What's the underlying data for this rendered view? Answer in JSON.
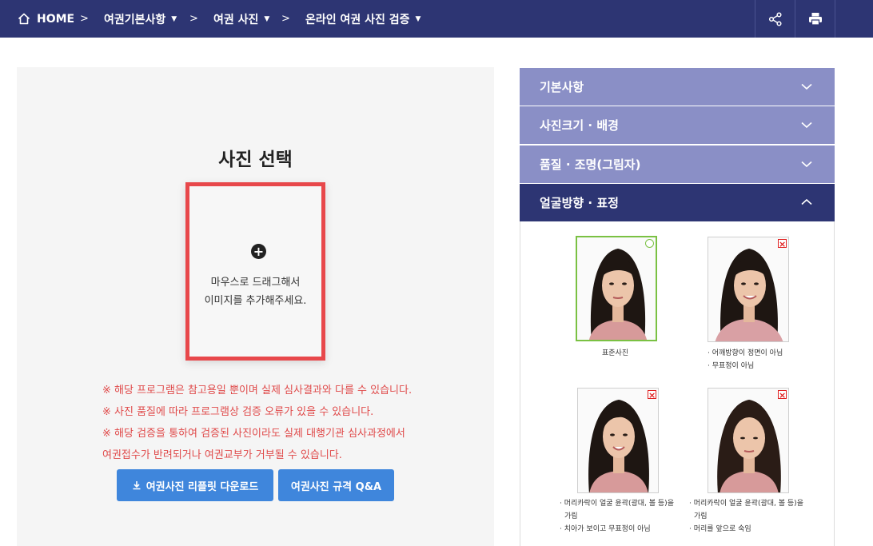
{
  "nav": {
    "home_label": "HOME",
    "crumbs": [
      {
        "label": "여권기본사항"
      },
      {
        "label": "여권 사진"
      },
      {
        "label": "온라인 여권 사진 검증"
      }
    ],
    "share_icon": "share-icon",
    "print_icon": "print-icon",
    "caret_icon": "caret-down-icon",
    "separator": ">"
  },
  "main": {
    "title": "사진 선택",
    "dropzone": {
      "icon": "plus-circle-icon",
      "line1": "마우스로 드래그해서",
      "line2": "이미지를 추가해주세요."
    },
    "notices": [
      "※ 해당 프로그램은 참고용일 뿐이며 실제 심사결과와 다를 수 있습니다.",
      "※ 사진 품질에 따라 프로그램상 검증 오류가 있을 수 있습니다.",
      "※ 해당 검증을 통하여 검증된 사진이라도 실제 대행기관 심사과정에서",
      "여권접수가 반려되거나 여권교부가 거부될 수 있습니다."
    ],
    "buttons": {
      "download_label": "여권사진 리플릿 다운로드",
      "download_icon": "download-icon",
      "qa_label": "여권사진 규격 Q&A"
    }
  },
  "accordion": {
    "items": [
      {
        "label": "기본사항",
        "expanded": false
      },
      {
        "label": "사진크기 · 배경",
        "expanded": false
      },
      {
        "label": "품질 · 조명(그림자)",
        "expanded": false
      },
      {
        "label": "얼굴방향 · 표정",
        "expanded": true
      }
    ],
    "examples": [
      {
        "status": "ok",
        "mark": "○",
        "captions": [
          "표준사진"
        ]
      },
      {
        "status": "bad",
        "mark": "×",
        "captions": [
          "· 어깨방향이 정면이 아님",
          "· 무표정이 아님"
        ]
      },
      {
        "status": "bad",
        "mark": "×",
        "captions": [
          "· 머리카락이 얼굴 윤곽(광대, 볼 등)을",
          "가림",
          "· 치아가 보이고 무표정이 아님"
        ]
      },
      {
        "status": "bad",
        "mark": "×",
        "captions": [
          "· 머리카락이 얼굴 윤곽(광대, 볼 등)을",
          "가림",
          "· 머리를 앞으로 숙임"
        ]
      }
    ]
  },
  "colors": {
    "nav_bg": "#2d3573",
    "accordion_closed": "#8a8fc6",
    "accordion_open": "#2d3573",
    "dropzone_border": "#e8484b",
    "notice_text": "#e04a4a",
    "button_bg": "#3f86dc",
    "ok_mark": "#7ac143",
    "bad_mark": "#e02020"
  }
}
